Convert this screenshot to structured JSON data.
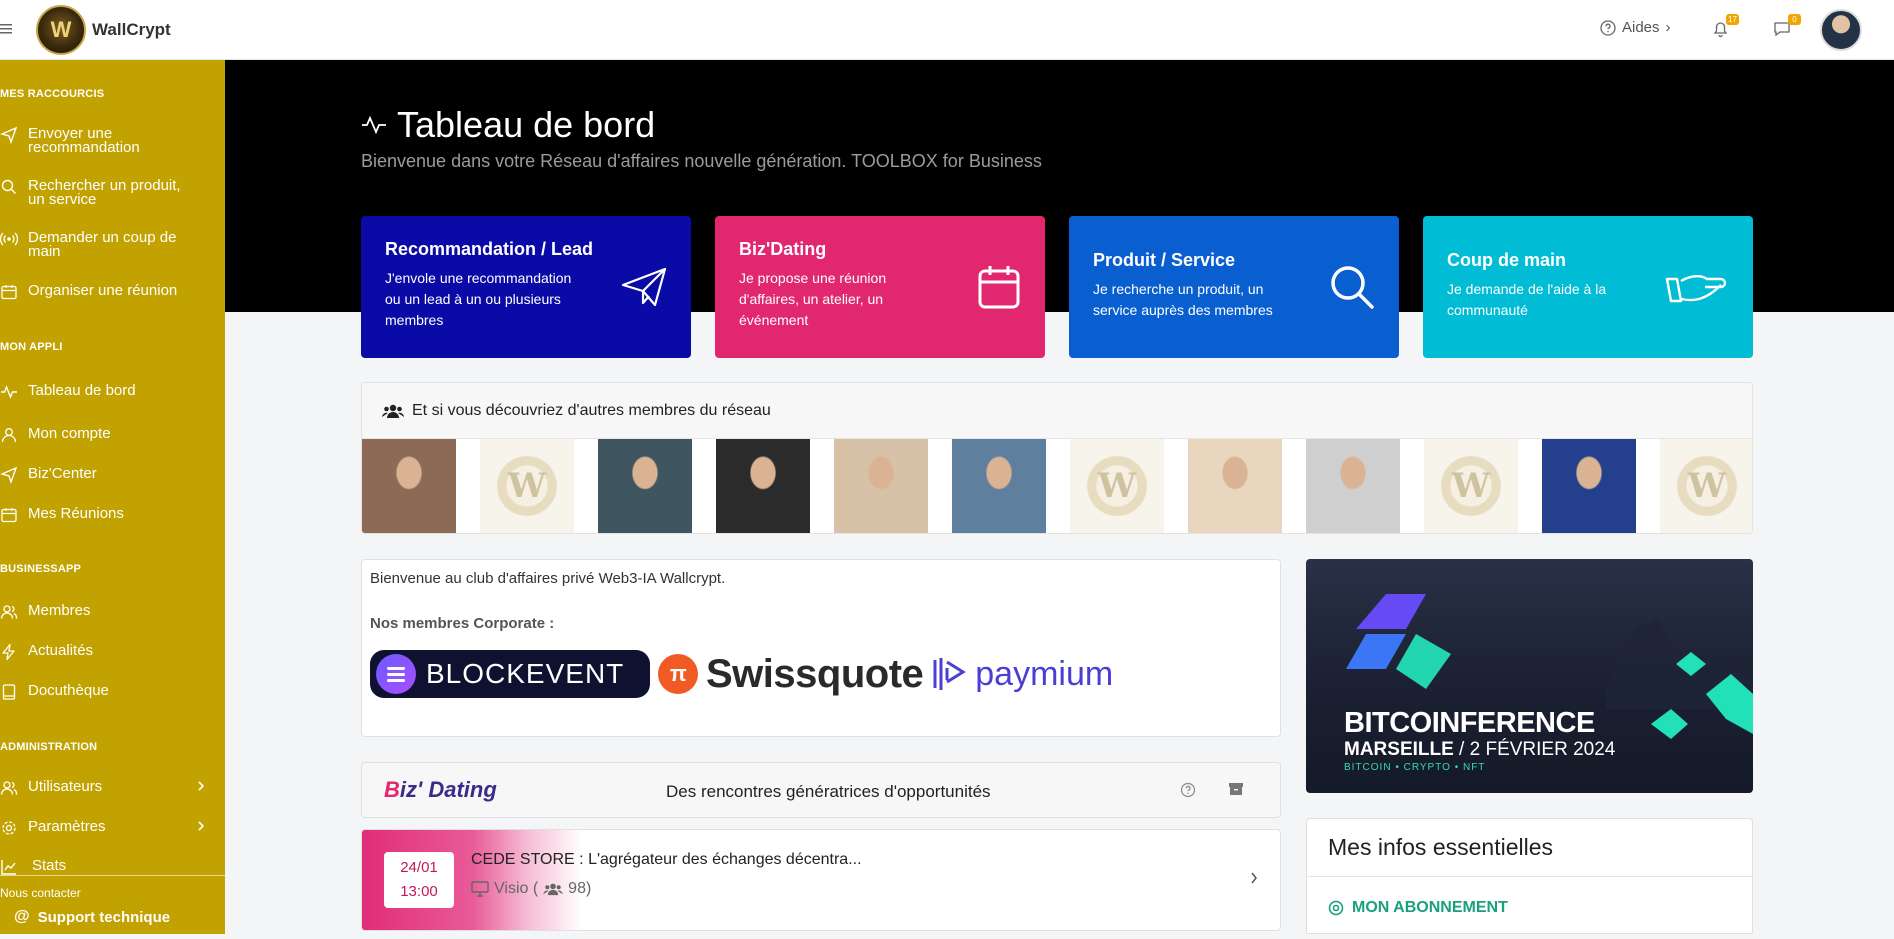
{
  "topbar": {
    "brand": "WallCrypt",
    "logo_letter": "W",
    "help_label": "Aides",
    "notifications_count": "17",
    "messages_count": "0"
  },
  "sidebar": {
    "sections": [
      {
        "title": "MES RACCOURCIS",
        "items": [
          {
            "label": "Envoyer une recommandation",
            "icon": "paper-plane-icon"
          },
          {
            "label": "Rechercher un produit, un service",
            "icon": "search-icon"
          },
          {
            "label": "Demander un coup de main",
            "icon": "broadcast-icon"
          },
          {
            "label": "Organiser une réunion",
            "icon": "calendar-icon"
          }
        ]
      },
      {
        "title": "MON APPLI",
        "items": [
          {
            "label": "Tableau de bord",
            "icon": "activity-icon"
          },
          {
            "label": "Mon compte",
            "icon": "user-icon"
          },
          {
            "label": "Biz'Center",
            "icon": "paper-plane-icon"
          },
          {
            "label": "Mes Réunions",
            "icon": "calendar-icon"
          }
        ]
      },
      {
        "title": "BUSINESSAPP",
        "items": [
          {
            "label": "Membres",
            "icon": "users-icon"
          },
          {
            "label": "Actualités",
            "icon": "lightning-icon"
          },
          {
            "label": "Docuthèque",
            "icon": "book-icon"
          }
        ]
      },
      {
        "title": "ADMINISTRATION",
        "items": [
          {
            "label": "Utilisateurs",
            "icon": "users-icon"
          },
          {
            "label": "Paramètres",
            "icon": "gear-icon"
          },
          {
            "label": "Stats",
            "icon": "chart-icon"
          }
        ]
      }
    ],
    "contact_label": "Nous contacter",
    "support_label": "Support technique"
  },
  "header": {
    "title": "Tableau de bord",
    "subtitle": "Bienvenue dans votre Réseau d'affaires nouvelle génération. TOOLBOX for Business"
  },
  "cards": [
    {
      "title": "Recommandation / Lead",
      "text": "J'envole une recommandation ou un lead à un ou plusieurs membres",
      "color": "#0a0aa6",
      "icon": "paper-plane-icon"
    },
    {
      "title": "Biz'Dating",
      "text": "Je propose une réunion d'affaires, un atelier, un événement",
      "color": "#e0276f",
      "icon": "calendar-icon"
    },
    {
      "title": "Produit / Service",
      "text": "Je recherche un produit, un service auprès des membres",
      "color": "#0a5fd0",
      "icon": "search-icon"
    },
    {
      "title": "Coup de main",
      "text": "Je demande de l'aide à la communauté",
      "color": "#00bcd4",
      "icon": "helping-hand-icon"
    }
  ],
  "members": {
    "heading": "Et si vous découvriez d'autres membres du réseau",
    "avatars": [
      {
        "kind": "photo",
        "bg": "#8c6a55"
      },
      {
        "kind": "logo"
      },
      {
        "kind": "photo",
        "bg": "#3f5560"
      },
      {
        "kind": "photo",
        "bg": "#2b2b2b"
      },
      {
        "kind": "photo",
        "bg": "#d7c2a8"
      },
      {
        "kind": "photo",
        "bg": "#5f7f9f"
      },
      {
        "kind": "logo"
      },
      {
        "kind": "photo",
        "bg": "#e8d6bf"
      },
      {
        "kind": "photo",
        "bg": "#cfcfcf"
      },
      {
        "kind": "logo"
      },
      {
        "kind": "photo",
        "bg": "#24408c"
      },
      {
        "kind": "logo"
      }
    ]
  },
  "welcome": {
    "text": "Bienvenue au club d'affaires privé Web3-IA Wallcrypt.",
    "corporate_label": "Nos membres Corporate :",
    "logos": [
      "BLOCKEVENT",
      "Swissquote",
      "paymium"
    ]
  },
  "bizdating": {
    "logo_b": "B",
    "logo_rest": "iz' Dating",
    "tagline": "Des rencontres génératrices d'opportunités"
  },
  "event": {
    "date": "24/01",
    "time": "13:00",
    "title": "CEDE STORE : L'agrégateur des échanges décentra...",
    "mode": "Visio (",
    "count": "98)"
  },
  "banner": {
    "title": "BITCOINFERENCE",
    "city": "MARSEILLE",
    "date": " / 2 FÉVRIER 2024",
    "tags": "BITCOIN • CRYPTO • NFT"
  },
  "infos": {
    "title": "Mes infos essentielles",
    "subscription": "MON ABONNEMENT"
  }
}
